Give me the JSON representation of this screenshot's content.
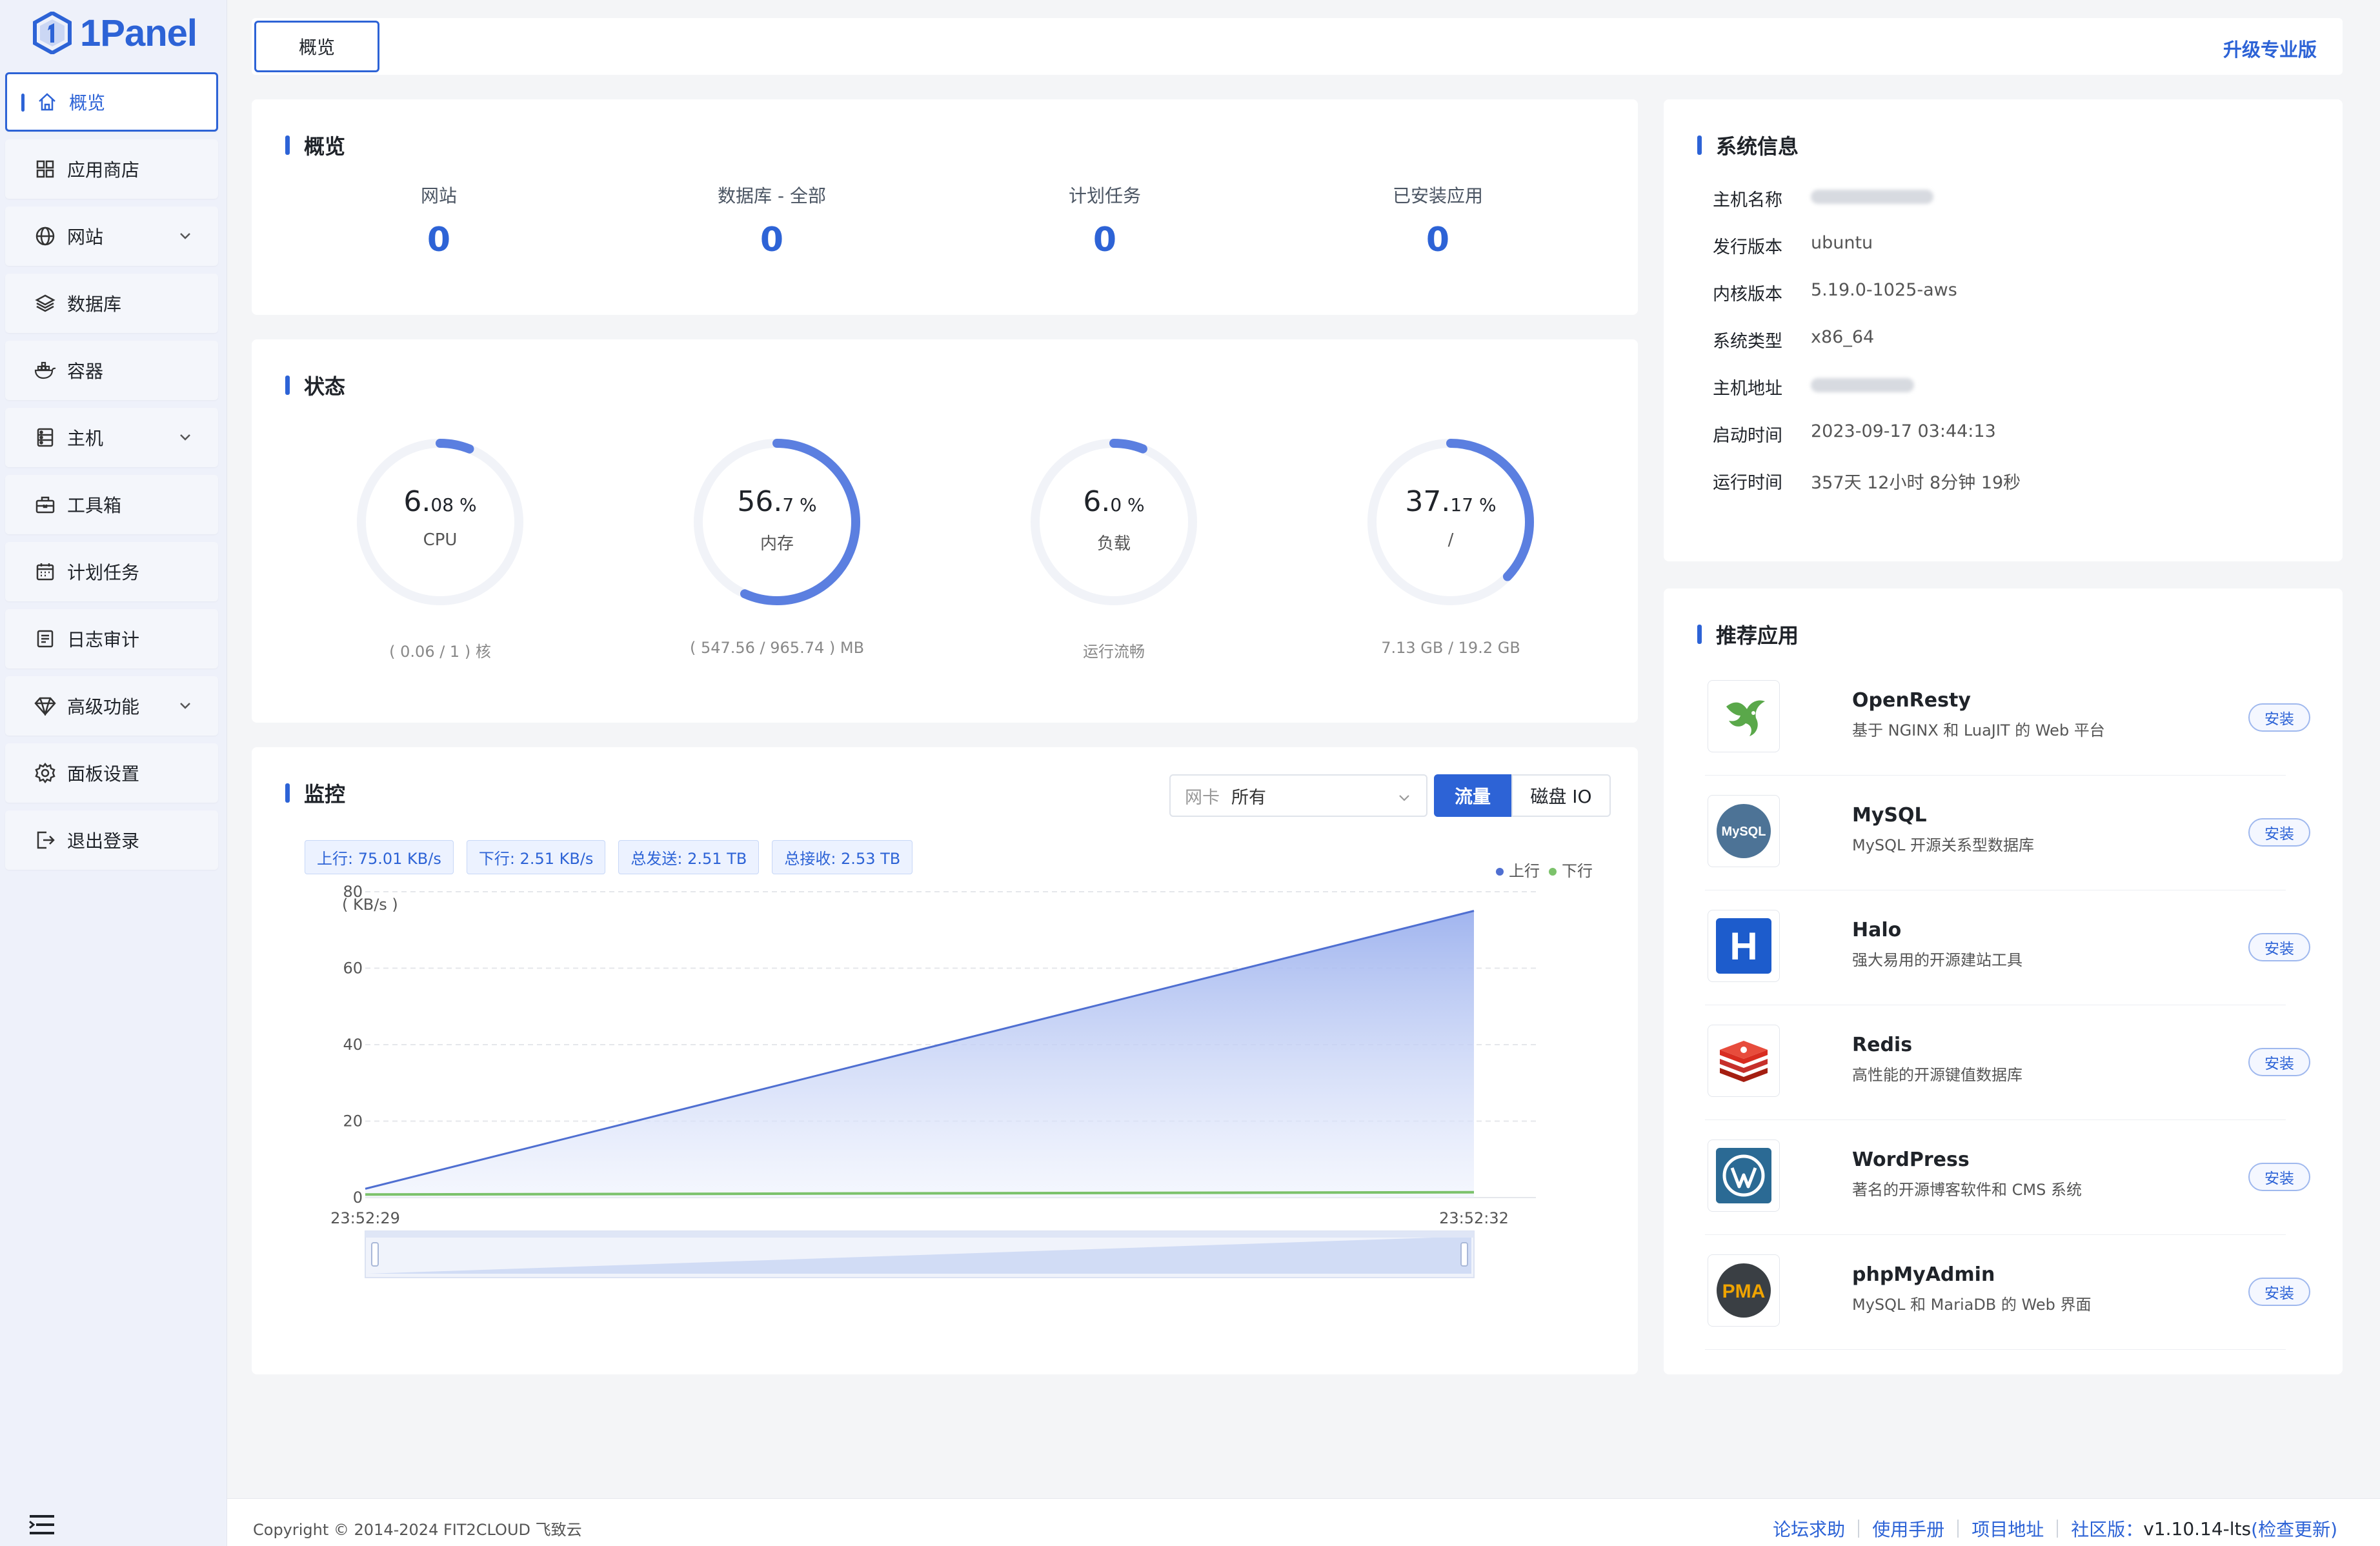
{
  "brand": {
    "name": "1Panel"
  },
  "sidebar": {
    "items": [
      {
        "label": "概览",
        "icon": "home-icon",
        "active": true
      },
      {
        "label": "应用商店",
        "icon": "app-grid-icon"
      },
      {
        "label": "网站",
        "icon": "globe-icon",
        "expandable": true
      },
      {
        "label": "数据库",
        "icon": "layers-icon"
      },
      {
        "label": "容器",
        "icon": "docker-icon"
      },
      {
        "label": "主机",
        "icon": "server-icon",
        "expandable": true
      },
      {
        "label": "工具箱",
        "icon": "toolbox-icon"
      },
      {
        "label": "计划任务",
        "icon": "calendar-icon"
      },
      {
        "label": "日志审计",
        "icon": "log-icon"
      },
      {
        "label": "高级功能",
        "icon": "diamond-icon",
        "expandable": true
      },
      {
        "label": "面板设置",
        "icon": "gear-icon"
      },
      {
        "label": "退出登录",
        "icon": "logout-icon"
      }
    ]
  },
  "topbar": {
    "tab": "概览",
    "upgrade": "升级专业版"
  },
  "overview": {
    "title": "概览",
    "items": [
      {
        "label": "网站",
        "value": "0"
      },
      {
        "label": "数据库 - 全部",
        "value": "0"
      },
      {
        "label": "计划任务",
        "value": "0"
      },
      {
        "label": "已安装应用",
        "value": "0"
      }
    ]
  },
  "status": {
    "title": "状态",
    "gauges": [
      {
        "int": "6.",
        "dec": "08",
        "unit": " %",
        "label": "CPU",
        "foot": "( 0.06 / 1 ) 核",
        "percent": 6.08
      },
      {
        "int": "56.",
        "dec": "7",
        "unit": " %",
        "label": "内存",
        "foot": "( 547.56 / 965.74 ) MB",
        "percent": 56.7
      },
      {
        "int": "6.",
        "dec": "0",
        "unit": " %",
        "label": "负载",
        "foot": "运行流畅",
        "percent": 6.0
      },
      {
        "int": "37.",
        "dec": "17",
        "unit": " %",
        "label": "/",
        "foot": "7.13 GB / 19.2 GB",
        "percent": 37.17
      }
    ]
  },
  "monitor": {
    "title": "监控",
    "nic_label": "网卡",
    "nic_value": "所有",
    "tab_traffic": "流量",
    "tab_disk": "磁盘 IO",
    "tags": [
      "上行: 75.01 KB/s",
      "下行: 2.51 KB/s",
      "总发送: 2.51 TB",
      "总接收: 2.53 TB"
    ],
    "legend_up": "上行",
    "legend_down": "下行"
  },
  "chart_data": {
    "type": "area",
    "ylabel": "( KB/s )",
    "ylim": [
      0,
      80
    ],
    "yticks": [
      0,
      20,
      40,
      60,
      80
    ],
    "x": [
      "23:52:29",
      "23:52:32"
    ],
    "series": [
      {
        "name": "上行",
        "values": [
          2.3,
          75.0
        ],
        "color": "#4f6fd1"
      },
      {
        "name": "下行",
        "values": [
          0.8,
          1.4
        ],
        "color": "#7cc26b"
      }
    ],
    "grid": true,
    "legend": "top-right"
  },
  "sysinfo": {
    "title": "系统信息",
    "rows": [
      {
        "key": "主机名称",
        "value": "",
        "hidden": true
      },
      {
        "key": "发行版本",
        "value": "ubuntu"
      },
      {
        "key": "内核版本",
        "value": "5.19.0-1025-aws"
      },
      {
        "key": "系统类型",
        "value": "x86_64"
      },
      {
        "key": "主机地址",
        "value": "",
        "hidden": true
      },
      {
        "key": "启动时间",
        "value": "2023-09-17 03:44:13"
      },
      {
        "key": "运行时间",
        "value": "357天 12小时 8分钟 19秒"
      }
    ]
  },
  "apps": {
    "title": "推荐应用",
    "install_label": "安装",
    "items": [
      {
        "name": "OpenResty",
        "desc": "基于 NGINX 和 LuaJIT 的 Web 平台",
        "icon": "openresty-icon"
      },
      {
        "name": "MySQL",
        "desc": "MySQL 开源关系型数据库",
        "icon": "mysql-icon"
      },
      {
        "name": "Halo",
        "desc": "强大易用的开源建站工具",
        "icon": "halo-icon"
      },
      {
        "name": "Redis",
        "desc": "高性能的开源键值数据库",
        "icon": "redis-icon"
      },
      {
        "name": "WordPress",
        "desc": "著名的开源博客软件和 CMS 系统",
        "icon": "wordpress-icon"
      },
      {
        "name": "phpMyAdmin",
        "desc": "MySQL 和 MariaDB 的 Web 界面",
        "icon": "phpmyadmin-icon"
      }
    ],
    "icon_text": {
      "mysql": "MySQL",
      "halo": "H",
      "pma": "PMA"
    }
  },
  "footer": {
    "copyright": "Copyright © 2014-2024 FIT2CLOUD 飞致云",
    "links": [
      "论坛求助",
      "使用手册",
      "项目地址"
    ],
    "edition_label": "社区版：",
    "version": "v1.10.14-lts",
    "check_update": "(检查更新)"
  },
  "colors": {
    "accent": "#2d63d6",
    "up": "#4f6fd1",
    "down": "#7cc26b"
  }
}
